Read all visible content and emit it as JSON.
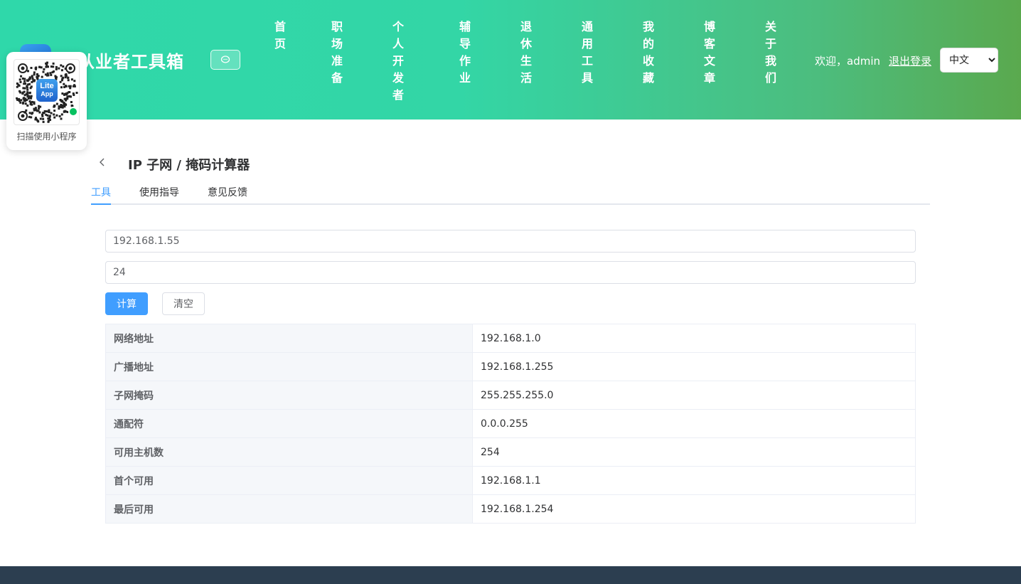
{
  "header": {
    "title": "件从业者工具箱",
    "nav": [
      "首页",
      "职场准备",
      "个人开发者",
      "辅导作业",
      "退休生活",
      "通用工具",
      "我的收藏",
      "博客文章",
      "关于我们"
    ],
    "welcome": "欢迎，admin",
    "logout": "退出登录",
    "language": {
      "selected": "中文",
      "options": [
        "中文"
      ]
    }
  },
  "qr": {
    "caption": "扫描使用小程序",
    "badge_line1": "Lite",
    "badge_line2": "App"
  },
  "page": {
    "title": "IP 子网 / 掩码计算器",
    "tabs": [
      "工具",
      "使用指导",
      "意见反馈"
    ]
  },
  "form": {
    "ip_value": "192.168.1.55",
    "mask_value": "24",
    "calc_label": "计算",
    "clear_label": "清空"
  },
  "results": [
    {
      "label": "网络地址",
      "value": "192.168.1.0"
    },
    {
      "label": "广播地址",
      "value": "192.168.1.255"
    },
    {
      "label": "子网掩码",
      "value": "255.255.255.0"
    },
    {
      "label": "通配符",
      "value": "0.0.0.255"
    },
    {
      "label": "可用主机数",
      "value": "254"
    },
    {
      "label": "首个可用",
      "value": "192.168.1.1"
    },
    {
      "label": "最后可用",
      "value": "192.168.1.254"
    }
  ],
  "colors": {
    "accent": "#409eff",
    "header_start": "#2fd8aa",
    "header_end": "#5aa94e",
    "footer": "#2c3e50"
  }
}
